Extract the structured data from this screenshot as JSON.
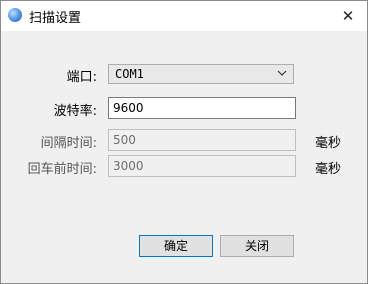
{
  "window": {
    "title": "扫描设置"
  },
  "form": {
    "port": {
      "label": "端口:",
      "value": "COM1"
    },
    "baud": {
      "label": "波特率:",
      "value": "9600"
    },
    "interval": {
      "label": "间隔时间:",
      "value": "500",
      "unit": "毫秒"
    },
    "enter_delay": {
      "label": "回车前时间:",
      "value": "3000",
      "unit": "毫秒"
    }
  },
  "buttons": {
    "ok": "确定",
    "close": "关闭"
  }
}
